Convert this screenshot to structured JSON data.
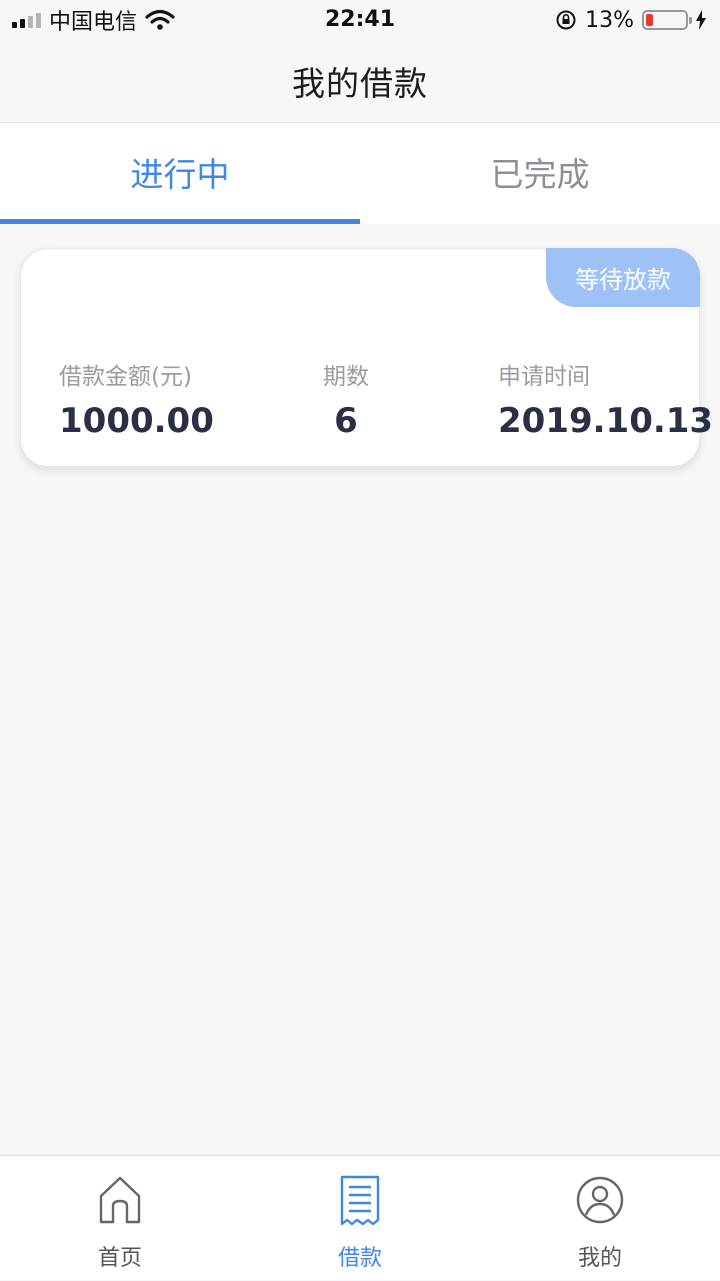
{
  "status_bar": {
    "carrier": "中国电信",
    "time": "22:41",
    "battery": "13%"
  },
  "nav": {
    "title": "我的借款"
  },
  "tabs": [
    {
      "label": "进行中",
      "active": true
    },
    {
      "label": "已完成",
      "active": false
    }
  ],
  "loan_card": {
    "badge": "等待放款",
    "amount_label": "借款金额(元)",
    "amount_value": "1000.00",
    "periods_label": "期数",
    "periods_value": "6",
    "date_label": "申请时间",
    "date_value": "2019.10.13"
  },
  "tab_bar": [
    {
      "label": "首页",
      "icon": "home-icon",
      "active": false
    },
    {
      "label": "借款",
      "icon": "receipt-icon",
      "active": true
    },
    {
      "label": "我的",
      "icon": "user-icon",
      "active": false
    }
  ],
  "colors": {
    "accent": "#3f87e2",
    "badge": "#9ec2f5",
    "battery_low": "#e8382f"
  }
}
